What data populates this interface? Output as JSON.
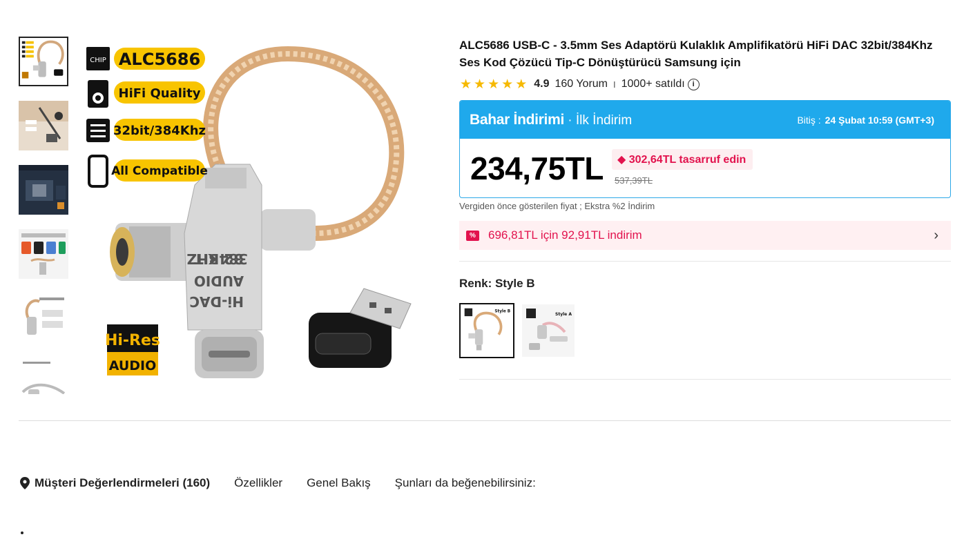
{
  "product": {
    "title": "ALC5686 USB-C - 3.5mm Ses Adaptörü Kulaklık Amplifikatörü HiFi DAC 32bit/384Khz Ses Kod Çözücü Tip-C Dönüştürücü Samsung için",
    "rating": "4.9",
    "rating_stars": 5,
    "review_count": "160 Yorum",
    "separator": "I",
    "sold": "1000+ satıldı",
    "info_icon": "info-icon"
  },
  "main_image": {
    "badges": [
      "ALC5686",
      "HiFi Quality",
      "32bit/384Khz",
      "All Compatible"
    ],
    "chip_label": "CHIP",
    "hires_top": "Hi-Res",
    "hires_bottom": "AUDIO",
    "body_text": [
      "384KHZ",
      "32 BIT",
      "AUDIO",
      "Hi-DAC"
    ]
  },
  "sale": {
    "name": "Bahar İndirimi",
    "sub": " · İlk İndirim",
    "ends_label": "Bitiş :",
    "ends_value": "24 Şubat 10:59 (GMT+3)",
    "price": "234,75TL",
    "savings": "302,64TL tasarruf edin",
    "old_price": "537,39TL",
    "colors": {
      "header": "#1fa9ec",
      "accent": "#e2124d"
    }
  },
  "tax_note": "Vergiden önce gösterilen fiyat ; Ekstra %2 İndirim",
  "coupon": {
    "icon": "%",
    "text": "696,81TL için 92,91TL indirim",
    "chevron": "›"
  },
  "color_option": {
    "label": "Renk: Style B",
    "swatches": [
      {
        "name": "Style B",
        "selected": true
      },
      {
        "name": "Style A",
        "selected": false
      }
    ]
  },
  "tabs": [
    {
      "label": "Müşteri Değerlendirmeleri (160)",
      "active": true
    },
    {
      "label": "Özellikler",
      "active": false
    },
    {
      "label": "Genel Bakış",
      "active": false
    },
    {
      "label": "Şunları da beğenebilirsiniz:",
      "active": false
    }
  ]
}
